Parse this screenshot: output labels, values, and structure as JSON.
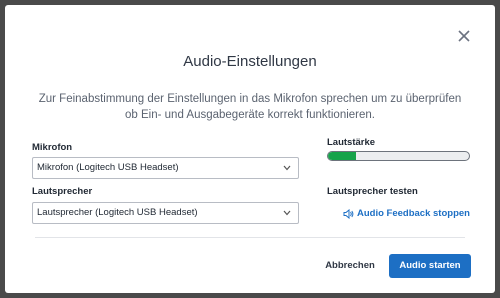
{
  "dialog": {
    "title": "Audio-Einstellungen",
    "description": "Zur Feinabstimmung der Einstellungen in das Mikrofon sprechen um zu überprüfen ob Ein- und Ausgabegeräte korrekt funktionieren."
  },
  "microphone": {
    "label": "Mikrofon",
    "selected": "Mikrofon (Logitech USB Headset)"
  },
  "speaker": {
    "label": "Lautsprecher",
    "selected": "Lautsprecher (Logitech USB Headset)"
  },
  "volume": {
    "label": "Lautstärke",
    "level_percent": 20,
    "fill_color": "#16a34a"
  },
  "speaker_test": {
    "label": "Lautsprecher testen",
    "link": "Audio Feedback stoppen",
    "icon": "speaker-icon"
  },
  "actions": {
    "cancel": "Abbrechen",
    "start": "Audio starten",
    "accent": "#1d6fc4"
  }
}
